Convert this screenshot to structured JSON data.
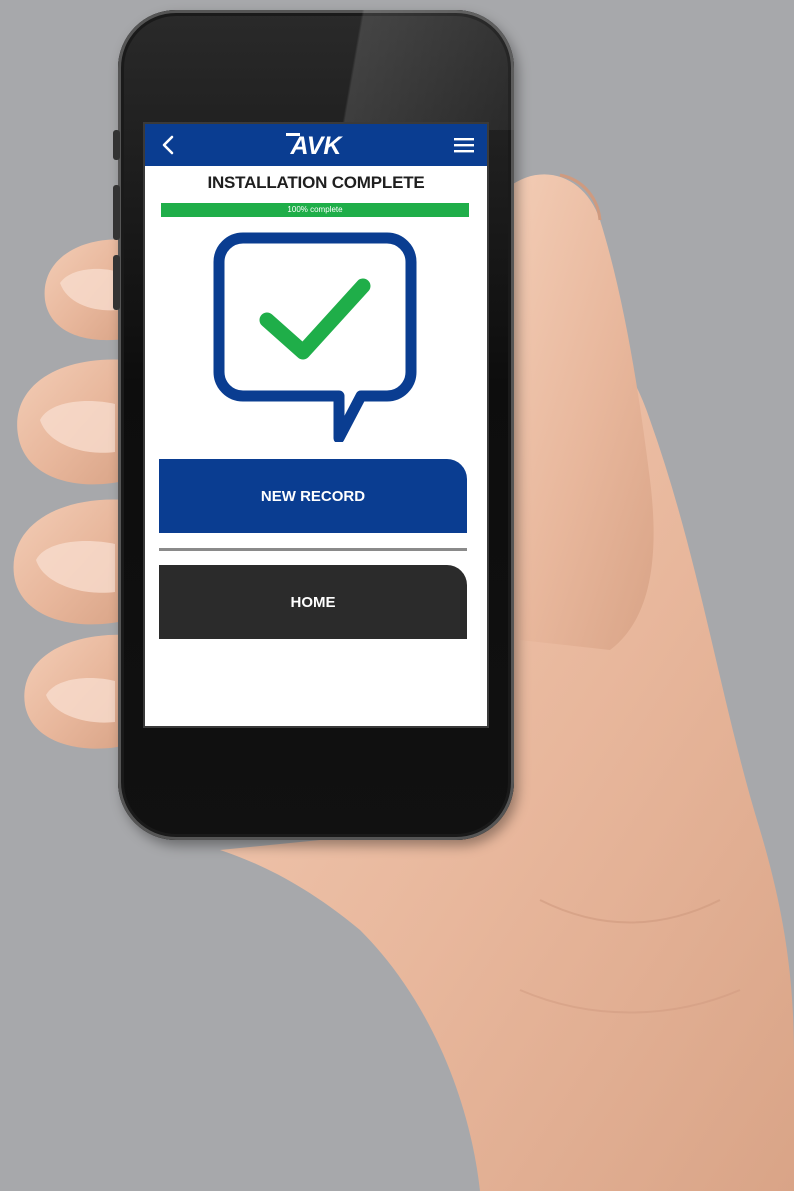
{
  "app": {
    "title": "INSTALLATION COMPLETE",
    "logo_text": "AVK"
  },
  "progress": {
    "label": "100% complete",
    "fraction": 1.0
  },
  "buttons": {
    "new_record": "NEW RECORD",
    "home": "HOME"
  },
  "icons": {
    "back": "chevron-left-icon",
    "menu": "hamburger-menu-icon",
    "success": "speech-bubble-check-icon"
  },
  "colors": {
    "brand_blue": "#0a3d91",
    "success_green": "#1fae49",
    "dark_button": "#2b2b2b",
    "background": "#a7a8ab"
  }
}
